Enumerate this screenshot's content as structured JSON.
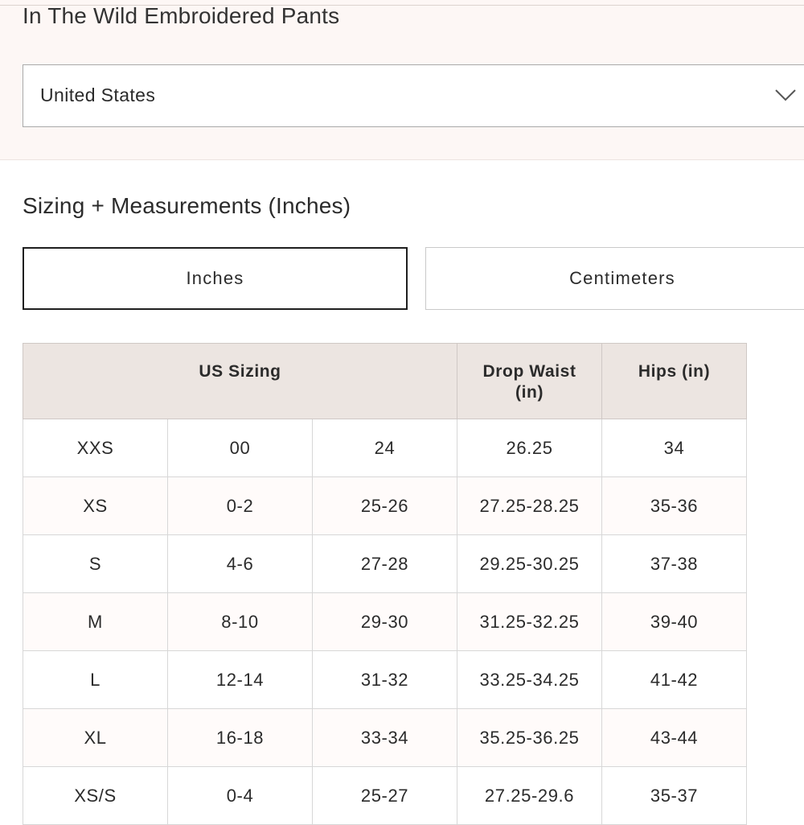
{
  "product": {
    "title": "In The Wild Embroidered Pants"
  },
  "country_select": {
    "selected": "United States",
    "icon": "chevron-down-icon"
  },
  "section": {
    "title": "Sizing + Measurements (Inches)"
  },
  "unit_toggle": {
    "inches_label": "Inches",
    "centimeters_label": "Centimeters",
    "active": "Inches"
  },
  "size_table": {
    "headers": {
      "us_sizing": "US Sizing",
      "drop_waist": "Drop Waist (in)",
      "hips": "Hips (in)"
    },
    "rows": [
      [
        "XXS",
        "00",
        "24",
        "26.25",
        "34"
      ],
      [
        "XS",
        "0-2",
        "25-26",
        "27.25-28.25",
        "35-36"
      ],
      [
        "S",
        "4-6",
        "27-28",
        "29.25-30.25",
        "37-38"
      ],
      [
        "M",
        "8-10",
        "29-30",
        "31.25-32.25",
        "39-40"
      ],
      [
        "L",
        "12-14",
        "31-32",
        "33.25-34.25",
        "41-42"
      ],
      [
        "XL",
        "16-18",
        "33-34",
        "35.25-36.25",
        "43-44"
      ],
      [
        "XS/S",
        "0-4",
        "25-27",
        "27.25-29.6",
        "35-37"
      ]
    ]
  },
  "colors": {
    "top_panel_bg": "#fdf7f5",
    "table_header_bg": "#ece5e1",
    "active_toggle_border": "#1f1f1f"
  }
}
